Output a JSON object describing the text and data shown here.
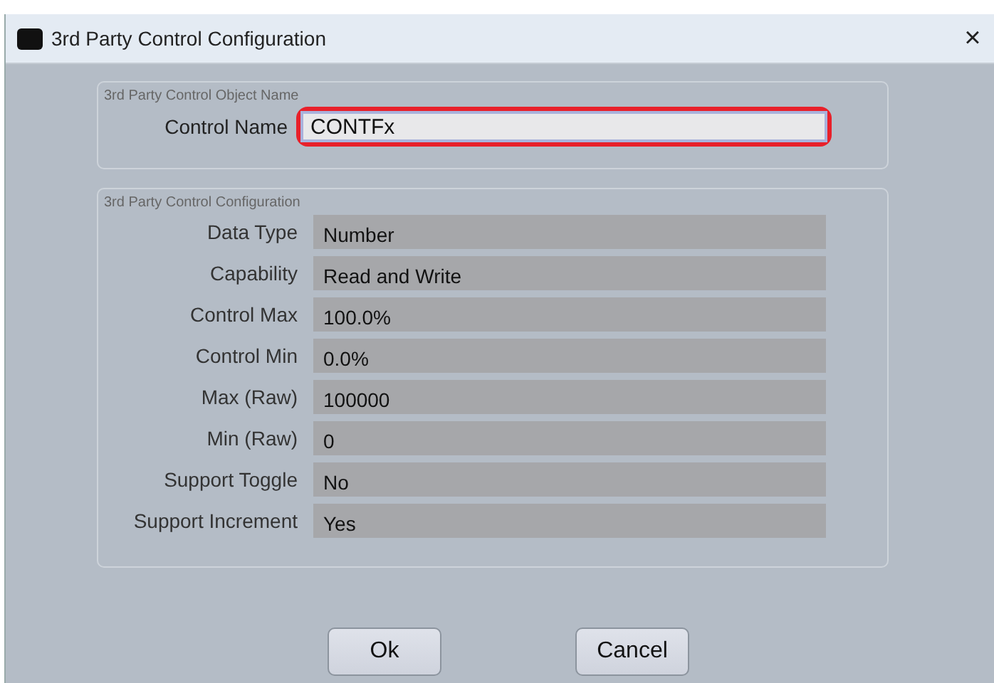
{
  "window": {
    "title": "3rd Party Control Configuration",
    "close": "×"
  },
  "name_group": {
    "legend": "3rd Party Control Object Name",
    "label": "Control Name",
    "value": "CONTFx",
    "highlighted": true
  },
  "config_group": {
    "legend": "3rd Party Control Configuration",
    "rows": [
      {
        "label": "Data Type",
        "value": "Number"
      },
      {
        "label": "Capability",
        "value": "Read and Write"
      },
      {
        "label": "Control Max",
        "value": "100.0%"
      },
      {
        "label": "Control Min",
        "value": "0.0%"
      },
      {
        "label": "Max (Raw)",
        "value": "100000"
      },
      {
        "label": "Min (Raw)",
        "value": "0"
      },
      {
        "label": "Support Toggle",
        "value": "No"
      },
      {
        "label": "Support Increment",
        "value": "Yes"
      }
    ]
  },
  "buttons": [
    "Ok",
    "Cancel"
  ]
}
